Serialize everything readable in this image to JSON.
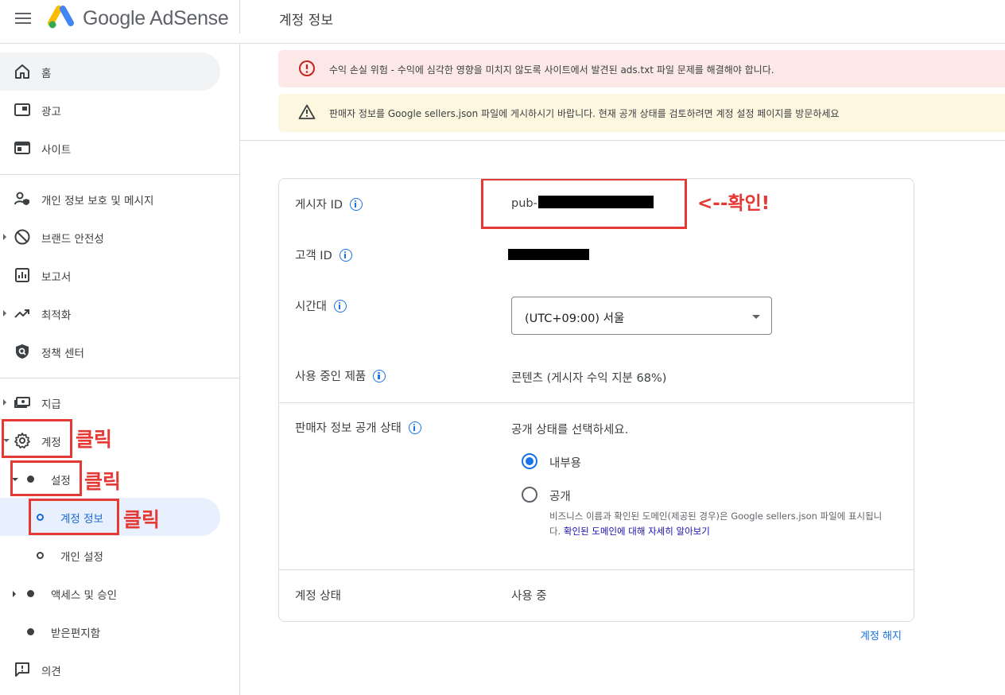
{
  "app": {
    "brand_google": "Google",
    "brand_product": "AdSense",
    "page_title": "계정 정보"
  },
  "sidebar": {
    "items": [
      {
        "label": "홈",
        "icon": "home-icon"
      },
      {
        "label": "광고",
        "icon": "ads-icon"
      },
      {
        "label": "사이트",
        "icon": "sites-icon"
      },
      {
        "label": "개인 정보 보호 및 메시지",
        "icon": "privacy-icon"
      },
      {
        "label": "브랜드 안전성",
        "icon": "block-icon"
      },
      {
        "label": "보고서",
        "icon": "reports-icon"
      },
      {
        "label": "최적화",
        "icon": "trending-icon"
      },
      {
        "label": "정책 센터",
        "icon": "policy-shield-icon"
      },
      {
        "label": "지급",
        "icon": "payments-icon"
      },
      {
        "label": "계정",
        "icon": "gear-icon"
      },
      {
        "label": "설정"
      },
      {
        "label": "계정 정보"
      },
      {
        "label": "개인 설정"
      },
      {
        "label": "액세스 및 승인"
      },
      {
        "label": "받은편지함"
      },
      {
        "label": "의견",
        "icon": "feedback-icon"
      }
    ]
  },
  "annotations": {
    "click": "클릭",
    "check": "<--확인!"
  },
  "banners": {
    "error": "수익 손실 위험 - 수익에 심각한 영향을 미치지 않도록 사이트에서 발견된 ads.txt 파일 문제를 해결해야 합니다.",
    "warning": "판매자 정보를 Google sellers.json 파일에 게시하시기 바랍니다. 현재 공개 상태를 검토하려면 계정 설정 페이지를 방문하세요"
  },
  "account": {
    "publisher_id_label": "게시자 ID",
    "publisher_id_prefix": "pub-",
    "customer_id_label": "고객 ID",
    "timezone_label": "시간대",
    "timezone_value": "(UTC+09:00) 서울",
    "products_label": "사용 중인 제품",
    "products_value": "콘텐츠 (게시자 수익 지분 68%)",
    "seller_visibility_label": "판매자 정보 공개 상태",
    "seller_visibility_prompt": "공개 상태를 선택하세요.",
    "option_internal": "내부용",
    "option_public": "공개",
    "help_text": "비즈니스 이름과 확인된 도메인(제공된 경우)은 Google sellers.json 파일에 표시됩니다.",
    "help_link": "확인된 도메인에 대해 자세히 알아보기",
    "status_label": "계정 상태",
    "status_value": "사용 중",
    "close_account": "계정 해지"
  },
  "colors": {
    "accent": "#1a73e8",
    "annotation_red": "#e53935",
    "error_bg": "#fce8e6",
    "warning_bg": "#fef7e0"
  }
}
